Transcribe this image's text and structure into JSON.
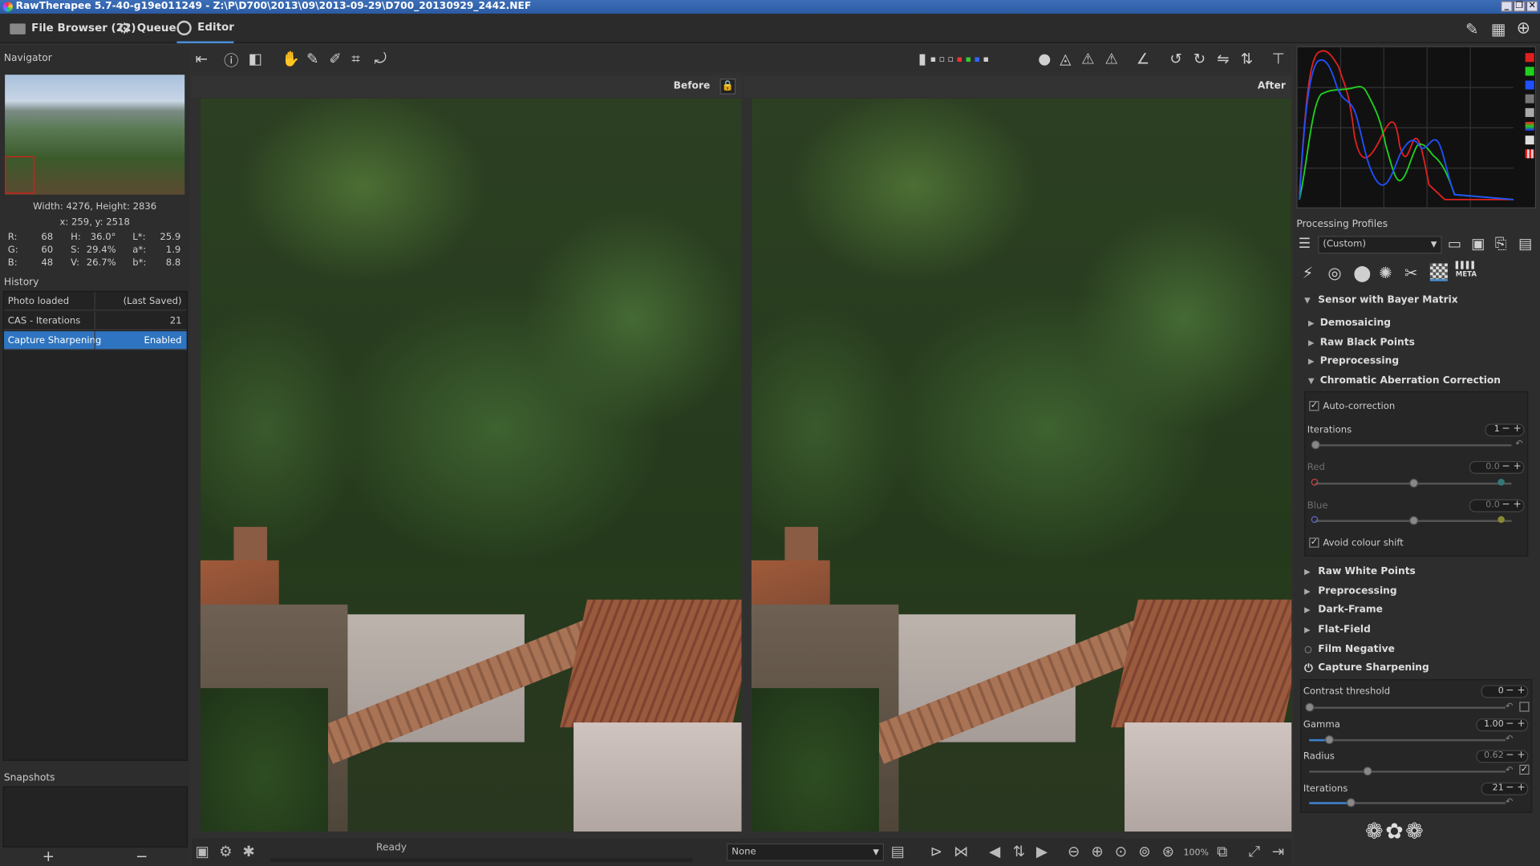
{
  "app": {
    "title": "RawTherapee 5.7-40-g19e011249 - Z:\\P\\D700\\2013\\09\\2013-09-29\\D700_20130929_2442.NEF"
  },
  "tabs": {
    "file_browser": "File Browser (22)",
    "queue": "Queue",
    "editor": "Editor"
  },
  "navigator": {
    "title": "Navigator",
    "size": "Width: 4276, Height: 2836",
    "pos": "x: 259, y: 2518",
    "rows": [
      [
        "R:",
        "68",
        "H:",
        "36.0°",
        "L*:",
        "25.9"
      ],
      [
        "G:",
        "60",
        "S:",
        "29.4%",
        "a*:",
        "1.9"
      ],
      [
        "B:",
        "48",
        "V:",
        "26.7%",
        "b*:",
        "8.8"
      ]
    ]
  },
  "history": {
    "title": "History",
    "rows": [
      {
        "name": "Photo loaded",
        "value": "(Last Saved)"
      },
      {
        "name": "CAS - Iterations",
        "value": "21"
      },
      {
        "name": "Capture Sharpening",
        "value": "Enabled"
      }
    ]
  },
  "snapshots": {
    "title": "Snapshots",
    "add": "+",
    "remove": "−"
  },
  "view": {
    "before": "Before",
    "after": "After"
  },
  "status": {
    "ready": "Ready",
    "zoom": "100%",
    "combo": "None"
  },
  "profiles": {
    "title": "Processing Profiles",
    "value": "(Custom)"
  },
  "tools": {
    "sensor": "Sensor with Bayer Matrix",
    "demosaicing": "Demosaicing",
    "raw_black": "Raw Black Points",
    "preprocessing1": "Preprocessing",
    "ca": "Chromatic Aberration Correction",
    "auto_correction": "Auto-correction",
    "iterations_label": "Iterations",
    "iterations_value": "1",
    "red_label": "Red",
    "red_value": "0.0",
    "blue_label": "Blue",
    "blue_value": "0.0",
    "avoid": "Avoid colour shift",
    "raw_white": "Raw White Points",
    "preprocessing2": "Preprocessing",
    "dark_frame": "Dark-Frame",
    "flat_field": "Flat-Field",
    "film_negative": "Film Negative",
    "capture_sharpening": "Capture Sharpening",
    "contrast_label": "Contrast threshold",
    "contrast_value": "0",
    "gamma_label": "Gamma",
    "gamma_value": "1.00",
    "radius_label": "Radius",
    "radius_value": "0.62",
    "iter2_label": "Iterations",
    "iter2_value": "21",
    "meta": "META"
  },
  "colors": {
    "accent": "#2f74c0",
    "hist_red": "#e02020",
    "hist_green": "#20d020",
    "hist_blue": "#2050ff"
  }
}
